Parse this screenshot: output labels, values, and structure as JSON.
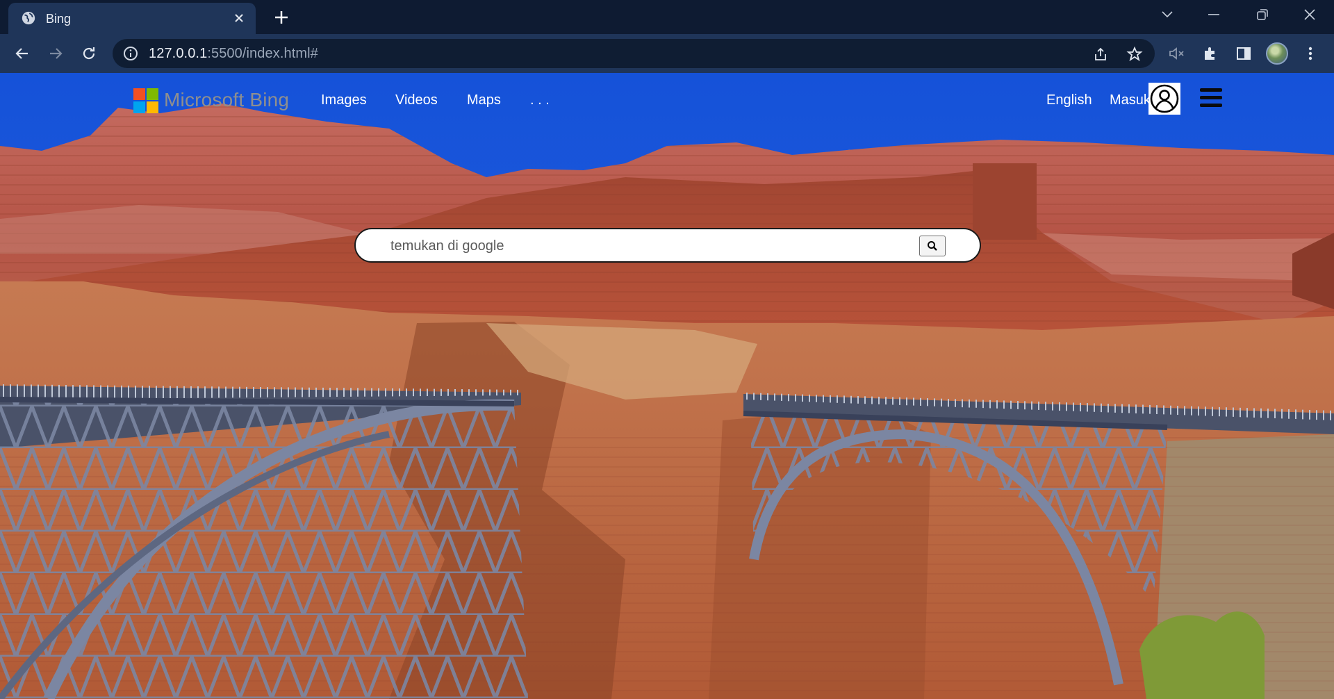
{
  "browser": {
    "tab": {
      "title": "Bing"
    },
    "url": {
      "host": "127.0.0.1",
      "path": ":5500/index.html#"
    }
  },
  "page": {
    "brand": "Microsoft Bing",
    "nav": [
      {
        "label": "Images"
      },
      {
        "label": "Videos"
      },
      {
        "label": "Maps"
      },
      {
        "label": ". . ."
      }
    ],
    "language": "English",
    "signin": "Masuk",
    "search": {
      "placeholder": "temukan di google",
      "value": ""
    }
  },
  "colors": {
    "sky": "#1d4fd6",
    "cliff": "#b8533c",
    "bridge": "#6c7893",
    "chrome_dark": "#0e1b32",
    "chrome_toolbar": "#1f3559"
  },
  "icons": [
    "globe-icon",
    "close-icon",
    "plus-icon",
    "chevron-down-icon",
    "minimize-icon",
    "restore-icon",
    "window-close-icon",
    "back-icon",
    "forward-icon",
    "reload-icon",
    "info-icon",
    "share-icon",
    "star-icon",
    "mute-icon",
    "extensions-icon",
    "sidepanel-icon",
    "profile-icon",
    "kebab-icon",
    "microsoft-logo-icon",
    "user-icon",
    "hamburger-icon",
    "search-icon"
  ]
}
